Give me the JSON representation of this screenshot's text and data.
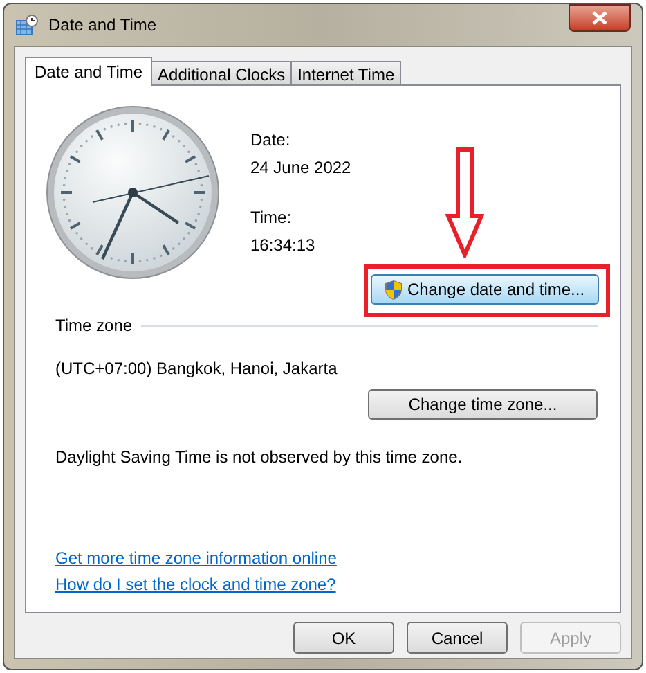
{
  "window": {
    "title": "Date and Time"
  },
  "tabs": [
    {
      "label": "Date and Time",
      "selected": true
    },
    {
      "label": "Additional Clocks",
      "selected": false
    },
    {
      "label": "Internet Time",
      "selected": false
    }
  ],
  "date_label": "Date:",
  "date": "24 June 2022",
  "time_label": "Time:",
  "time": "16:34:13",
  "change_datetime_button": "Change date and time...",
  "time_zone": {
    "heading": "Time zone",
    "value": "(UTC+07:00) Bangkok, Hanoi, Jakarta",
    "button": "Change time zone..."
  },
  "dst_note": "Daylight Saving Time is not observed by this time zone.",
  "links": [
    "Get more time zone information online",
    "How do I set the clock and time zone?"
  ],
  "buttons": [
    {
      "label": "OK",
      "disabled": false
    },
    {
      "label": "Cancel",
      "disabled": false
    },
    {
      "label": "Apply",
      "disabled": true
    }
  ]
}
